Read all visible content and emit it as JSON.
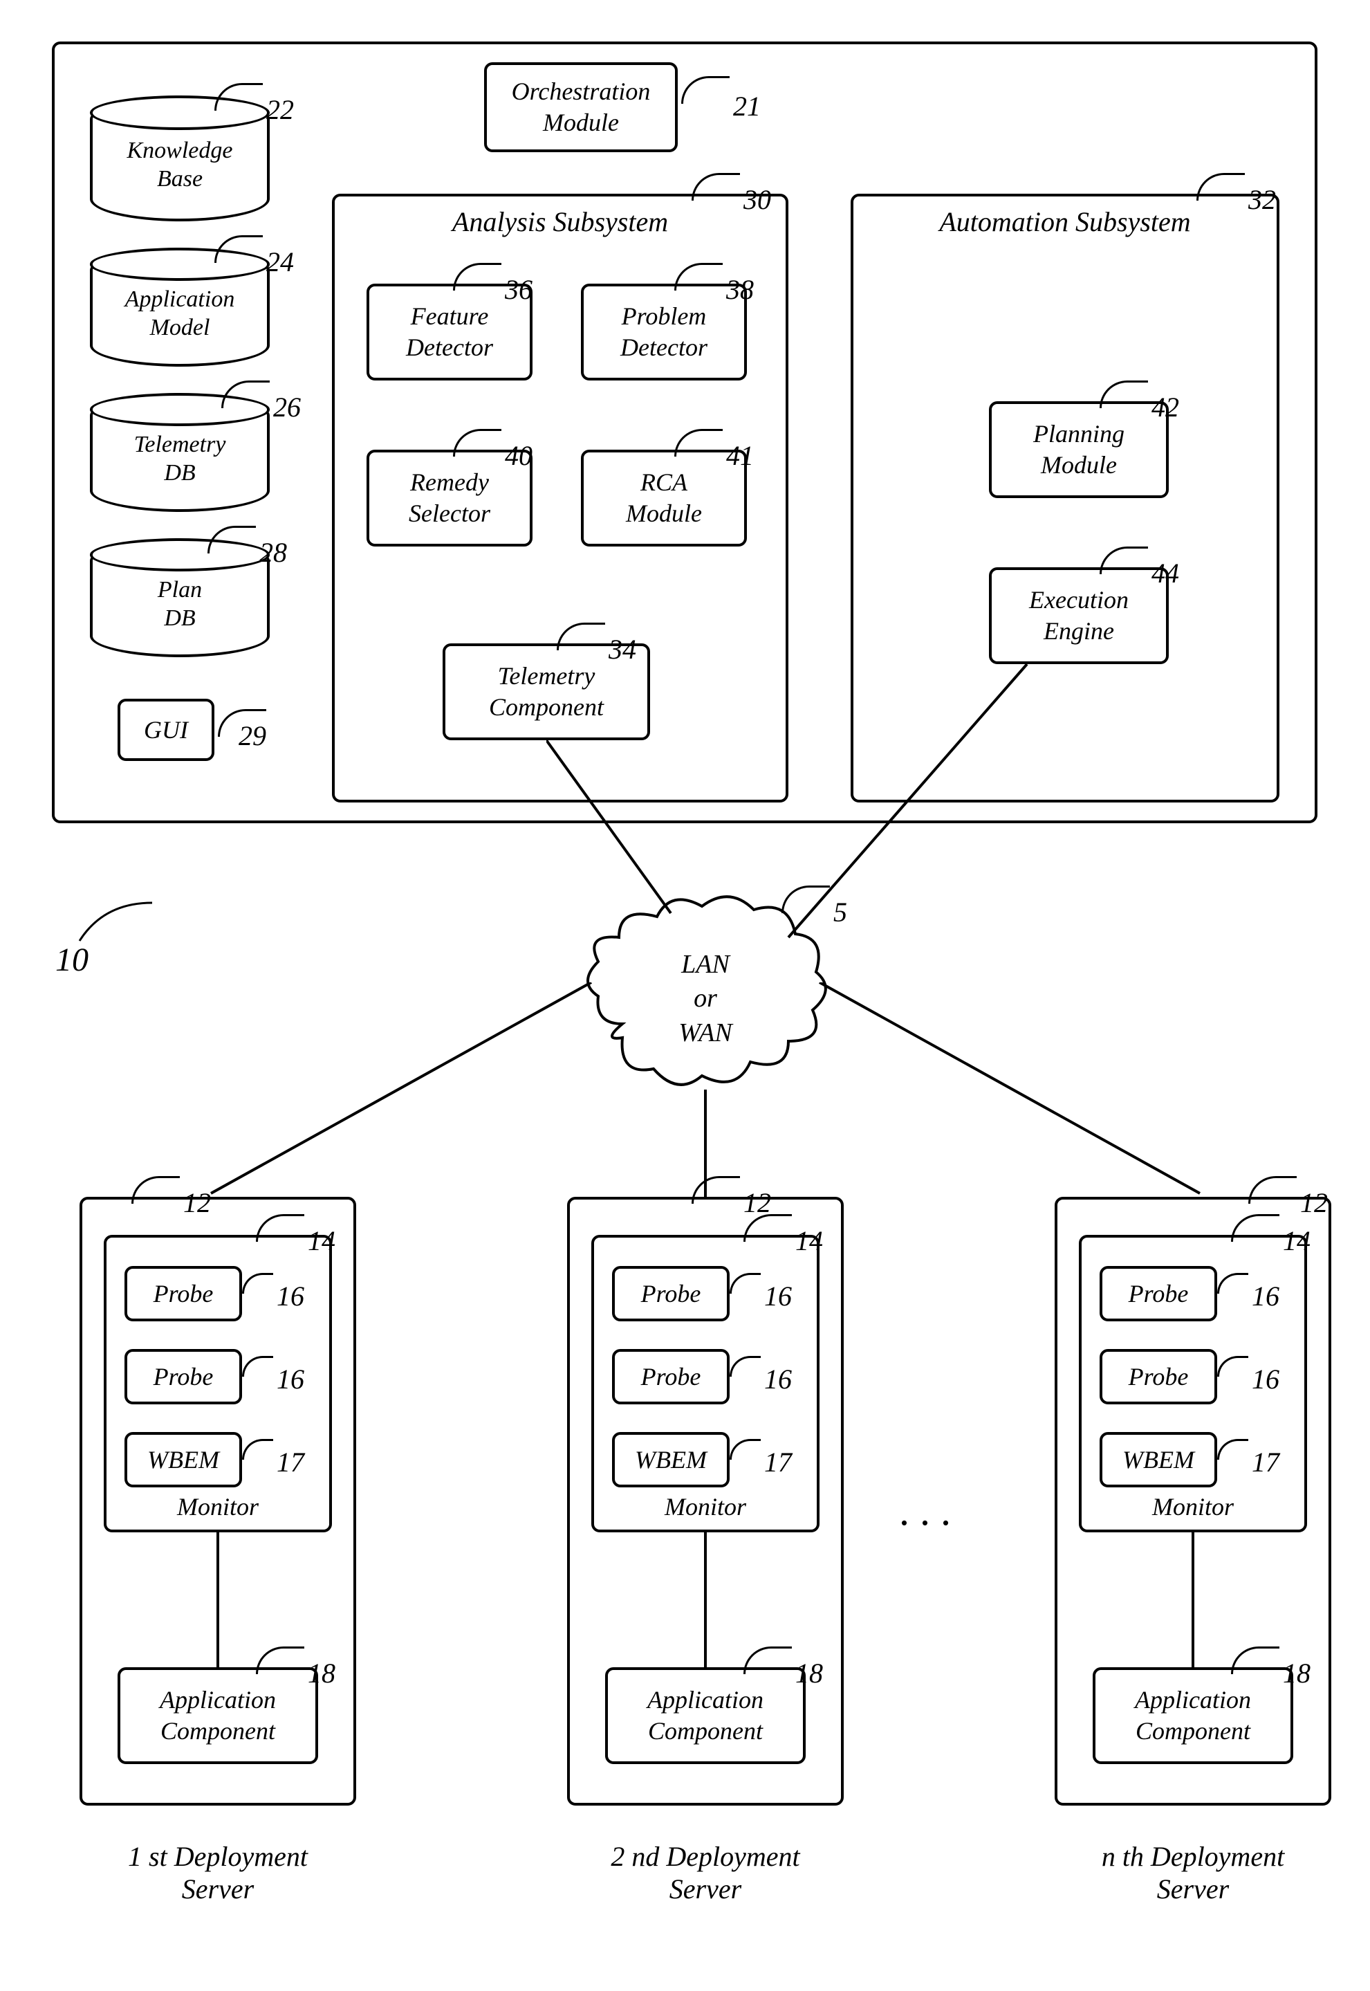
{
  "top": {
    "orchestration": "Orchestration\nModule",
    "analysis_title": "Analysis Subsystem",
    "automation_title": "Automation Subsystem",
    "feature_detector": "Feature\nDetector",
    "problem_detector": "Problem\nDetector",
    "remedy_selector": "Remedy\nSelector",
    "rca_module": "RCA\nModule",
    "telemetry_component": "Telemetry\nComponent",
    "planning_module": "Planning\nModule",
    "execution_engine": "Execution\nEngine",
    "kb": "Knowledge\nBase",
    "app_model": "Application\nModel",
    "telemetry_db": "Telemetry\nDB",
    "plan_db": "Plan\nDB",
    "gui": "GUI"
  },
  "refs": {
    "r5": "5",
    "r10": "10",
    "r12": "12",
    "r14": "14",
    "r16": "16",
    "r17": "17",
    "r18": "18",
    "r21": "21",
    "r22": "22",
    "r24": "24",
    "r26": "26",
    "r28": "28",
    "r29": "29",
    "r30": "30",
    "r32": "32",
    "r34": "34",
    "r36": "36",
    "r38": "38",
    "r40": "40",
    "r41": "41",
    "r42": "42",
    "r44": "44"
  },
  "cloud": "LAN\nor\nWAN",
  "server": {
    "probe": "Probe",
    "wbem": "WBEM",
    "monitor": "Monitor",
    "app_component": "Application\nComponent",
    "label1": "1 st Deployment\nServer",
    "label2": "2 nd Deployment\nServer",
    "labeln": "n th Deployment\nServer"
  },
  "ellipsis": ". . ."
}
